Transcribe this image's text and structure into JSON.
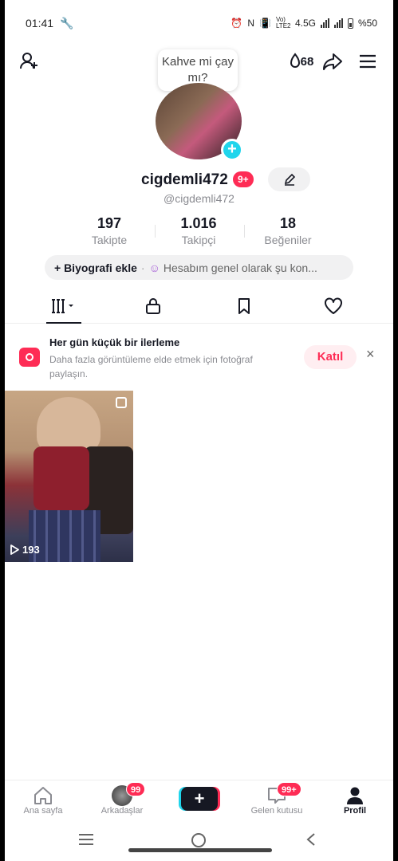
{
  "status": {
    "time": "01:41",
    "indicators": "N",
    "network": "4.5G",
    "volte": "Vo) LTE2",
    "battery": "%50"
  },
  "header": {
    "streak": "68",
    "tooltip": "Kahve mi çay mı?"
  },
  "profile": {
    "username": "cigdemli472",
    "username_badge": "9+",
    "handle": "@cigdemli472",
    "stats": [
      {
        "value": "197",
        "label": "Takipte"
      },
      {
        "value": "1.016",
        "label": "Takipçi"
      },
      {
        "value": "18",
        "label": "Beğeniler"
      }
    ],
    "bio_add": "+ Biyografi ekle",
    "bio_hint": "Hesabım genel olarak şu kon..."
  },
  "promo": {
    "title": "Her gün küçük bir ilerleme",
    "description": "Daha fazla görüntüleme elde etmek için fotoğraf paylaşın.",
    "join": "Katıl",
    "close": "×"
  },
  "videos": [
    {
      "views": "193"
    }
  ],
  "bottom_nav": {
    "home": "Ana sayfa",
    "friends": "Arkadaşlar",
    "friends_badge": "99",
    "inbox": "Gelen kutusu",
    "inbox_badge": "99+",
    "profile": "Profil"
  }
}
